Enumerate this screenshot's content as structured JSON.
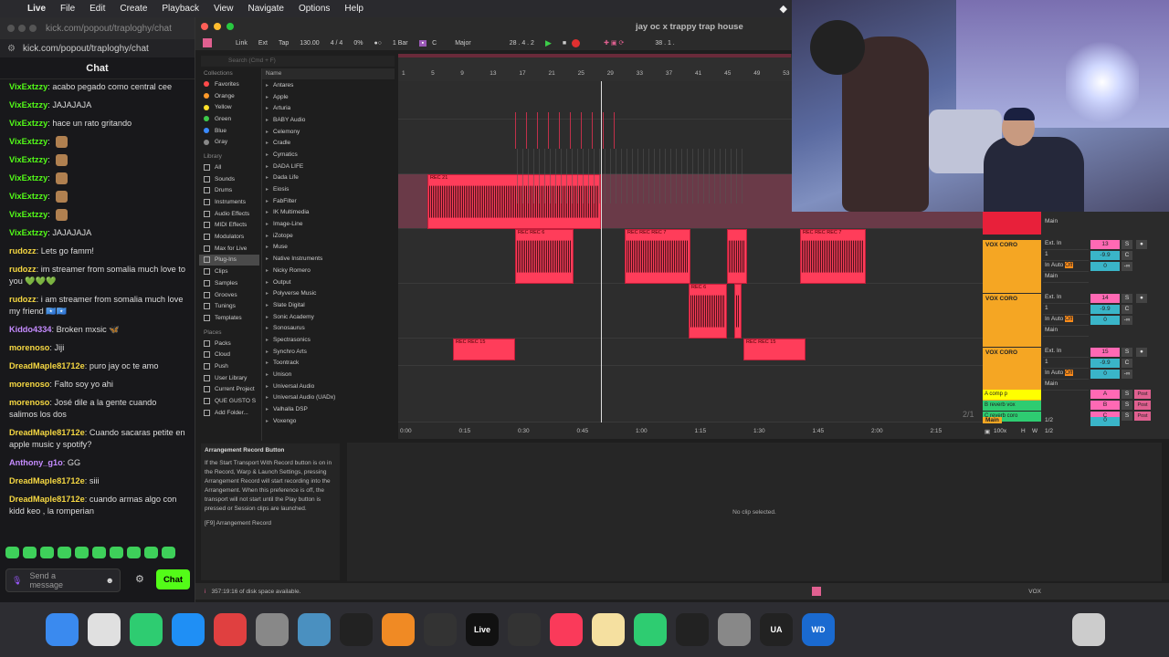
{
  "menubar": {
    "app": "Live",
    "items": [
      "File",
      "Edit",
      "Create",
      "Playback",
      "View",
      "Navigate",
      "Options",
      "Help"
    ]
  },
  "chat": {
    "title_url": "kick.com/popout/traploghy/chat",
    "url": "kick.com/popout/traploghy/chat",
    "header": "Chat",
    "messages": [
      {
        "user": "VixExtzzy",
        "text": "acabo pegado como central cee",
        "color": "#53fc18"
      },
      {
        "user": "VixExtzzy",
        "text": "JAJAJAJA",
        "color": "#53fc18"
      },
      {
        "user": "VixExtzzy",
        "text": "hace un rato gritando",
        "color": "#53fc18"
      },
      {
        "user": "VixExtzzy",
        "text": "",
        "color": "#53fc18",
        "emote": true
      },
      {
        "user": "VixExtzzy",
        "text": "",
        "color": "#53fc18",
        "emote": true
      },
      {
        "user": "VixExtzzy",
        "text": "",
        "color": "#53fc18",
        "emote": true
      },
      {
        "user": "VixExtzzy",
        "text": "",
        "color": "#53fc18",
        "emote": true
      },
      {
        "user": "VixExtzzy",
        "text": "",
        "color": "#53fc18",
        "emote": true
      },
      {
        "user": "VixExtzzy",
        "text": "JAJAJAJA",
        "color": "#53fc18"
      },
      {
        "user": "rudozz",
        "text": "Lets go famm!",
        "color": "#f5d742"
      },
      {
        "user": "rudozz",
        "text": "im streamer from somalia much love to you 💚💚💚",
        "color": "#f5d742"
      },
      {
        "user": "rudozz",
        "text": "i am streamer from somalia much love my friend 🇸🇴🇸🇴",
        "color": "#f5d742"
      },
      {
        "user": "Kiddo4334",
        "text": "Broken mxsic 🦋",
        "color": "#c58bff"
      },
      {
        "user": "morenoso",
        "text": "Jiji",
        "color": "#f5d742"
      },
      {
        "user": "DreadMaple81712e",
        "text": "puro jay oc te amo",
        "color": "#f5d742"
      },
      {
        "user": "morenoso",
        "text": "Falto soy yo ahi",
        "color": "#f5d742"
      },
      {
        "user": "morenoso",
        "text": "José dile a la gente cuando salimos los dos",
        "color": "#f5d742"
      },
      {
        "user": "DreadMaple81712e",
        "text": "Cuando sacaras petite en apple music y spotify?",
        "color": "#f5d742"
      },
      {
        "user": "Anthony_g1o",
        "text": "GG",
        "color": "#c58bff"
      },
      {
        "user": "DreadMaple81712e",
        "text": "siii",
        "color": "#f5d742"
      },
      {
        "user": "DreadMaple81712e",
        "text": "cuando armas algo con kidd keo , la romperian",
        "color": "#f5d742"
      }
    ],
    "send_placeholder": "Send a message",
    "chat_button": "Chat"
  },
  "live": {
    "window_title": "jay oc x trappy trap house",
    "transport": {
      "link": "Link",
      "ext": "Ext",
      "tap": "Tap",
      "tempo": "130.00",
      "signature": "4 / 4",
      "metronome": "0%",
      "quantize": "1 Bar",
      "key": "C",
      "scale": "Major",
      "position": "28 .  4 .  2",
      "loop_end": "38 .  1 ."
    },
    "search_placeholder": "Search (Cmd + F)",
    "collections_header": "Collections",
    "collections": [
      {
        "label": "Favorites",
        "color": "#ff4a4a"
      },
      {
        "label": "Orange",
        "color": "#ff9a2a"
      },
      {
        "label": "Yellow",
        "color": "#ffe02a"
      },
      {
        "label": "Green",
        "color": "#3ecb4a"
      },
      {
        "label": "Blue",
        "color": "#3a8aff"
      },
      {
        "label": "Gray",
        "color": "#888888"
      }
    ],
    "library_header": "Library",
    "library": [
      "All",
      "Sounds",
      "Drums",
      "Instruments",
      "Audio Effects",
      "MIDI Effects",
      "Modulators",
      "Max for Live",
      "Plug-Ins",
      "Clips",
      "Samples",
      "Grooves",
      "Tunings",
      "Templates"
    ],
    "library_selected": "Plug-Ins",
    "places_header": "Places",
    "places": [
      "Packs",
      "Cloud",
      "Push",
      "User Library",
      "Current Project",
      "QUE GUSTO S",
      "Add Folder..."
    ],
    "name_header": "Name",
    "plugins": [
      "Antares",
      "Apple",
      "Arturia",
      "BABY Audio",
      "Celemony",
      "Cradle",
      "Cymatics",
      "DADA LIFE",
      "Dada Life",
      "Eiosis",
      "FabFilter",
      "IK Multimedia",
      "Image-Line",
      "iZotope",
      "Muse",
      "Native Instruments",
      "Nicky Romero",
      "Output",
      "Polyverse Music",
      "Slate Digital",
      "Sonic Academy",
      "Sonosaurus",
      "Spectrasonics",
      "Synchro Arts",
      "Toontrack",
      "Unison",
      "Universal Audio",
      "Universal Audio (UADx)",
      "Valhalla DSP",
      "Voxengo"
    ],
    "info_title": "Arrangement Record Button",
    "info_body": "If the Start Transport With Record button is on in the Record, Warp & Launch Settings, pressing Arrangement Record will start recording into the Arrangement. When this preference is off, the transport will not start until the Play button is pressed or Session clips are launched.",
    "info_shortcut": "[F9] Arrangement Record",
    "no_clip": "No clip selected.",
    "disk_status": "357:19:16 of disk space available.",
    "status_track": "VOX",
    "ruler_bars": [
      "1",
      "5",
      "9",
      "13",
      "17",
      "21",
      "25",
      "29",
      "33",
      "37",
      "41",
      "45",
      "49",
      "53"
    ],
    "time_marks": [
      "0:00",
      "0:15",
      "0:30",
      "0:45",
      "1:00",
      "1:15",
      "1:30",
      "1:45",
      "2:00",
      "2:15"
    ],
    "ratio": "2/1",
    "clips": [
      {
        "label": "REC 21",
        "track": 3
      },
      {
        "label": "REC REC 6",
        "track": 4
      },
      {
        "label": "REC REC REC 7",
        "track": 4
      },
      {
        "label": "REC REC REC 7",
        "track": 4
      },
      {
        "label": "REC 6",
        "track": 5
      },
      {
        "label": "REC REC 15",
        "track": 6
      },
      {
        "label": "REC REC 15",
        "track": 6
      }
    ],
    "mixer": {
      "tracks": [
        {
          "name": "VOX CORO",
          "input": "Ext. In",
          "ch": "1",
          "num": "13",
          "vol": "-9.9",
          "pan": "C",
          "out": "Main"
        },
        {
          "name": "VOX CORO",
          "input": "Ext. In",
          "ch": "1",
          "num": "14",
          "vol": "-9.9",
          "pan": "C",
          "out": "Main"
        },
        {
          "name": "VOX CORO",
          "input": "Ext. In",
          "ch": "1",
          "num": "15",
          "vol": "-9.9",
          "pan": "C",
          "out": "Main"
        }
      ],
      "monitor": {
        "in": "In",
        "auto": "Auto",
        "off": "Off",
        "zero": "0",
        "inf": "-∞"
      },
      "returns": [
        {
          "name": "A comp p",
          "letter": "A",
          "color": "#ffff00"
        },
        {
          "name": "B reverb vox",
          "letter": "B",
          "color": "#2ecc71"
        },
        {
          "name": "C reverb coro",
          "letter": "C",
          "color": "#2ecc71"
        }
      ],
      "main_label": "Main",
      "main_ratio": "1/2",
      "main_ratio2": "1/2",
      "zoom": "100x",
      "h": "H",
      "w": "W",
      "s": "S",
      "post": "Post"
    }
  },
  "dock": {
    "apps": [
      {
        "name": "finder",
        "color": "#3a8aef",
        "label": ""
      },
      {
        "name": "launchpad",
        "color": "#e0e0e0",
        "label": ""
      },
      {
        "name": "facetime",
        "color": "#2ecc71",
        "label": ""
      },
      {
        "name": "app-store",
        "color": "#1f8ff5",
        "label": ""
      },
      {
        "name": "chrome",
        "color": "#e04040",
        "label": ""
      },
      {
        "name": "ua-connect",
        "color": "#888",
        "label": ""
      },
      {
        "name": "ua-console",
        "color": "#4a90c0",
        "label": ""
      },
      {
        "name": "capcut",
        "color": "#222",
        "label": ""
      },
      {
        "name": "fl-studio",
        "color": "#f08a24",
        "label": ""
      },
      {
        "name": "capcut2",
        "color": "#333",
        "label": ""
      },
      {
        "name": "ableton",
        "color": "#111",
        "label": "Live"
      },
      {
        "name": "obs",
        "color": "#333",
        "label": ""
      },
      {
        "name": "music",
        "color": "#fa3a5a",
        "label": ""
      },
      {
        "name": "notes",
        "color": "#f5e0a0",
        "label": ""
      },
      {
        "name": "whatsapp",
        "color": "#2ecc71",
        "label": ""
      },
      {
        "name": "chatgpt",
        "color": "#222",
        "label": ""
      },
      {
        "name": "settings",
        "color": "#888",
        "label": ""
      },
      {
        "name": "ua",
        "color": "#222",
        "label": "UA"
      },
      {
        "name": "wd",
        "color": "#1a6ad0",
        "label": "WD"
      }
    ]
  }
}
